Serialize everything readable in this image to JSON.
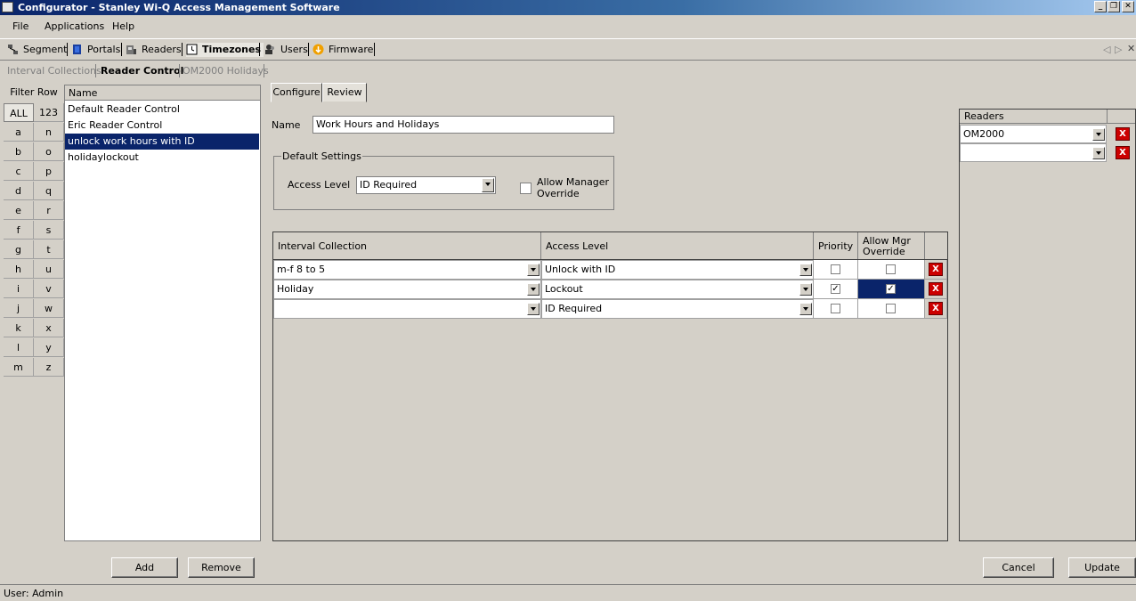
{
  "window": {
    "title": "Configurator - Stanley Wi-Q Access Management Software"
  },
  "menu": [
    "File",
    "Applications",
    "Help"
  ],
  "toolbar": {
    "segment": "Segment",
    "portals": "Portals",
    "readers": "Readers",
    "timezones": "Timezones",
    "users": "Users",
    "firmware": "Firmware"
  },
  "subtabs": {
    "interval": "Interval Collections",
    "reader_control": "Reader Control",
    "holidays": "OM2000 Holidays"
  },
  "filter": {
    "header": "Filter Row",
    "name_header": "Name",
    "all": "ALL",
    "num": "123",
    "left": [
      "a",
      "b",
      "c",
      "d",
      "e",
      "f",
      "g",
      "h",
      "i",
      "j",
      "k",
      "l",
      "m"
    ],
    "right": [
      "n",
      "o",
      "p",
      "q",
      "r",
      "s",
      "t",
      "u",
      "v",
      "w",
      "x",
      "y",
      "z"
    ]
  },
  "list": [
    "Default Reader Control",
    "Eric Reader Control",
    "unlock work hours with ID",
    "holidaylockout"
  ],
  "tabs": {
    "configure": "Configure",
    "review": "Review"
  },
  "form": {
    "name_label": "Name",
    "name_value": "Work Hours and Holidays",
    "default_settings": "Default Settings",
    "access_level_label": "Access Level",
    "access_level_value": "ID Required",
    "allow_mgr_line1": "Allow Manager",
    "allow_mgr_line2": "Override"
  },
  "grid": {
    "h_interval": "Interval Collection",
    "h_access": "Access Level",
    "h_priority": "Priority",
    "h_mgr1": "Allow Mgr",
    "h_mgr2": "Override",
    "rows": [
      {
        "interval": "m-f 8 to 5",
        "access": "Unlock with ID",
        "priority": false,
        "mgr": false
      },
      {
        "interval": "Holiday",
        "access": "Lockout",
        "priority": true,
        "mgr": true
      },
      {
        "interval": "",
        "access": "ID Required",
        "priority": false,
        "mgr": false
      }
    ]
  },
  "readers": {
    "header": "Readers",
    "rows": [
      "OM2000",
      ""
    ]
  },
  "buttons": {
    "add": "Add",
    "remove": "Remove",
    "cancel": "Cancel",
    "update": "Update"
  },
  "status": "User: Admin"
}
